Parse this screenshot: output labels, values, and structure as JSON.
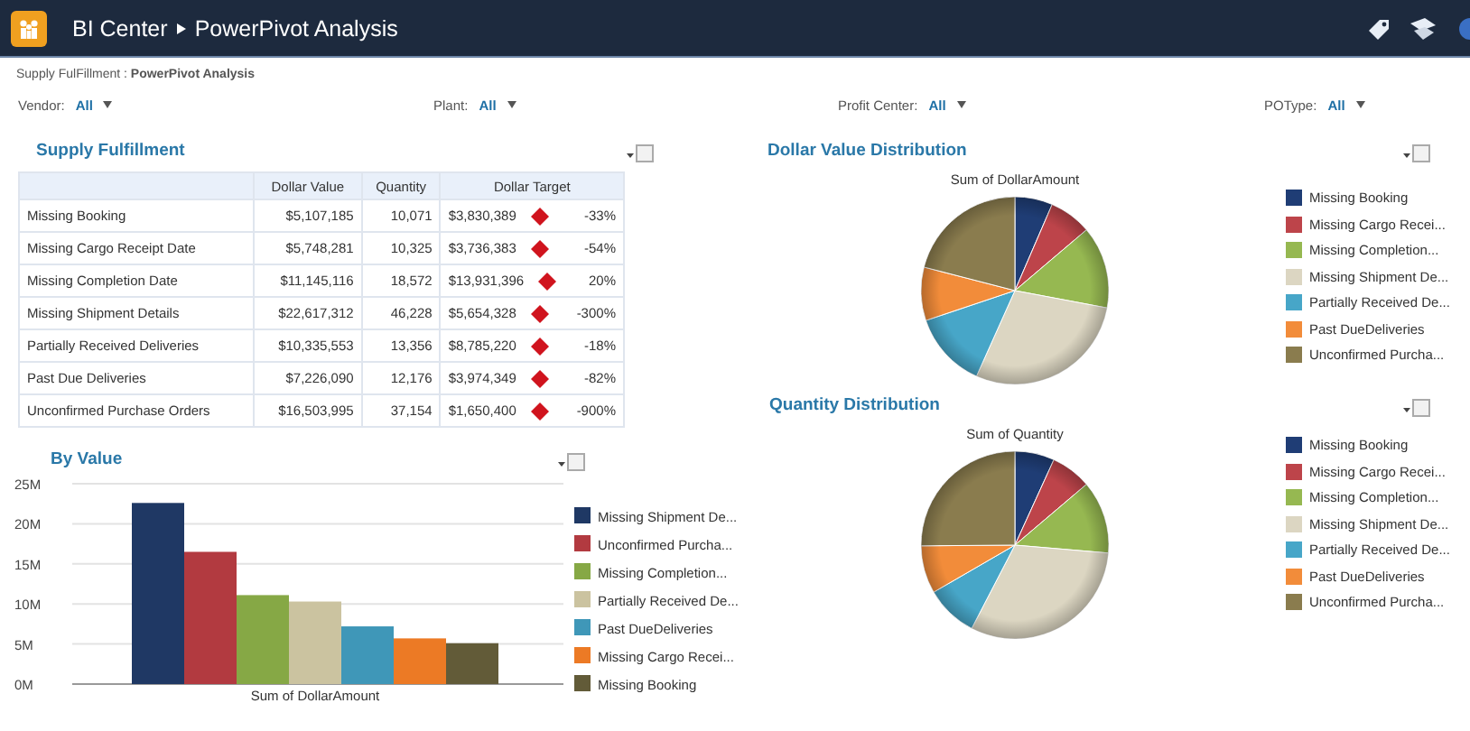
{
  "header": {
    "breadcrumb": [
      "BI Center",
      "PowerPivot Analysis"
    ]
  },
  "page_path": "Supply FulFillment : **PowerPivot Analysis**",
  "filters": [
    {
      "label": "Vendor:",
      "value": "All"
    },
    {
      "label": "Plant:",
      "value": "All"
    },
    {
      "label": "Profit Center:",
      "value": "All"
    },
    {
      "label": "POType:",
      "value": "All"
    }
  ],
  "supply_fulfillment": {
    "title": "Supply Fulfillment",
    "table": {
      "columns": [
        "Dollar Value",
        "Quantity",
        "Dollar Target"
      ],
      "rows": [
        {
          "name": "Missing Booking",
          "dollar_value": "$5,107,185",
          "quantity": "10,071",
          "dollar_target": "$3,830,389",
          "variance": "-33%"
        },
        {
          "name": "Missing Cargo Receipt Date",
          "dollar_value": "$5,748,281",
          "quantity": "10,325",
          "dollar_target": "$3,736,383",
          "variance": "-54%"
        },
        {
          "name": "Missing Completion Date",
          "dollar_value": "$11,145,116",
          "quantity": "18,572",
          "dollar_target": "$13,931,396",
          "variance": "20%"
        },
        {
          "name": "Missing Shipment Details",
          "dollar_value": "$22,617,312",
          "quantity": "46,228",
          "dollar_target": "$5,654,328",
          "variance": "-300%"
        },
        {
          "name": "Partially Received Deliveries",
          "dollar_value": "$10,335,553",
          "quantity": "13,356",
          "dollar_target": "$8,785,220",
          "variance": "-18%"
        },
        {
          "name": "Past Due Deliveries",
          "dollar_value": "$7,226,090",
          "quantity": "12,176",
          "dollar_target": "$3,974,349",
          "variance": "-82%"
        },
        {
          "name": "Unconfirmed Purchase Orders",
          "dollar_value": "$16,503,995",
          "quantity": "37,154",
          "dollar_target": "$1,650,400",
          "variance": "-900%"
        }
      ]
    }
  },
  "by_value": {
    "title": "By Value",
    "chart_data": {
      "type": "bar",
      "grid": true,
      "legend": true,
      "categories": [
        "Sum of DollarAmount"
      ],
      "ylim": [
        0,
        25000000
      ],
      "yticks": [
        {
          "value": 0,
          "label": "0M"
        },
        {
          "value": 5000000,
          "label": "5M"
        },
        {
          "value": 10000000,
          "label": "10M"
        },
        {
          "value": 15000000,
          "label": "15M"
        },
        {
          "value": 20000000,
          "label": "20M"
        },
        {
          "value": 25000000,
          "label": "25M"
        }
      ],
      "series": [
        {
          "name": "Missing Shipment De...",
          "color": "#1f3864",
          "values": [
            22600000
          ]
        },
        {
          "name": "Unconfirmed Purcha...",
          "color": "#b23a40",
          "values": [
            16500000
          ]
        },
        {
          "name": "Missing Completion...",
          "color": "#86a845",
          "values": [
            11100000
          ]
        },
        {
          "name": "Partially Received De...",
          "color": "#cbc3a0",
          "values": [
            10300000
          ]
        },
        {
          "name": "Past DueDeliveries",
          "color": "#3f97b8",
          "values": [
            7200000
          ]
        },
        {
          "name": "Missing Cargo Recei...",
          "color": "#ec7a25",
          "values": [
            5700000
          ]
        },
        {
          "name": "Missing Booking",
          "color": "#625b38",
          "values": [
            5100000
          ]
        }
      ]
    }
  },
  "dollar_distribution": {
    "title": "Dollar Value Distribution",
    "chart_title": "Sum of DollarAmount",
    "legend": [
      {
        "label": "Missing Booking",
        "color": "#1f3d75"
      },
      {
        "label": "Missing Cargo Recei...",
        "color": "#bd444a"
      },
      {
        "label": "Missing Completion...",
        "color": "#96b851"
      },
      {
        "label": "Missing Shipment De...",
        "color": "#dcd6c2"
      },
      {
        "label": "Partially Received De...",
        "color": "#47a6c8"
      },
      {
        "label": "Past DueDeliveries",
        "color": "#f28c3a"
      },
      {
        "label": "Unconfirmed Purcha...",
        "color": "#8a7c4e"
      }
    ]
  },
  "quantity_distribution": {
    "title": "Quantity Distribution",
    "chart_title": "Sum of Quantity",
    "legend": [
      {
        "label": "Missing Booking",
        "color": "#1f3d75"
      },
      {
        "label": "Missing Cargo Recei...",
        "color": "#bd444a"
      },
      {
        "label": "Missing Completion...",
        "color": "#96b851"
      },
      {
        "label": "Missing Shipment De...",
        "color": "#dcd6c2"
      },
      {
        "label": "Partially Received De...",
        "color": "#47a6c8"
      },
      {
        "label": "Past DueDeliveries",
        "color": "#f28c3a"
      },
      {
        "label": "Unconfirmed Purcha...",
        "color": "#8a7c4e"
      }
    ]
  }
}
